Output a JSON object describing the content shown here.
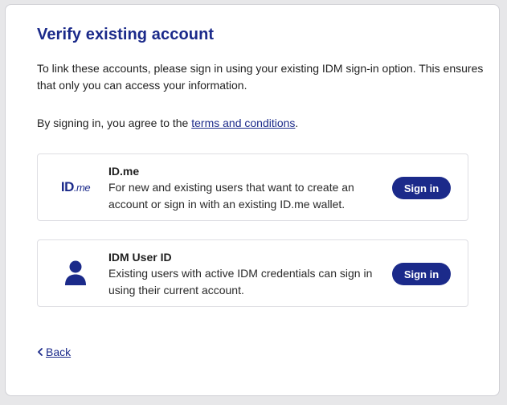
{
  "page": {
    "title": "Verify existing account",
    "intro": "To link these accounts, please sign in using your existing IDM sign-in option. This ensures that only you can access your information.",
    "agree_prefix": "By signing in, you agree to the ",
    "terms_link": "terms and conditions",
    "agree_suffix": "."
  },
  "options": [
    {
      "logo_main": "ID",
      "logo_suffix": ".me",
      "icon": "idme-logo",
      "name": "ID.me",
      "description": "For new and existing users that want to create an account or sign in with an existing ID.me wallet.",
      "button_label": "Sign in"
    },
    {
      "icon": "user-icon",
      "name": "IDM User ID",
      "description": "Existing users with active IDM credentials can sign in using their current account.",
      "button_label": "Sign in"
    }
  ],
  "back": {
    "label": "Back",
    "icon": "chevron-left-icon"
  },
  "colors": {
    "brand": "#1b2a8a",
    "background": "#e7e7e9",
    "card": "#ffffff"
  }
}
